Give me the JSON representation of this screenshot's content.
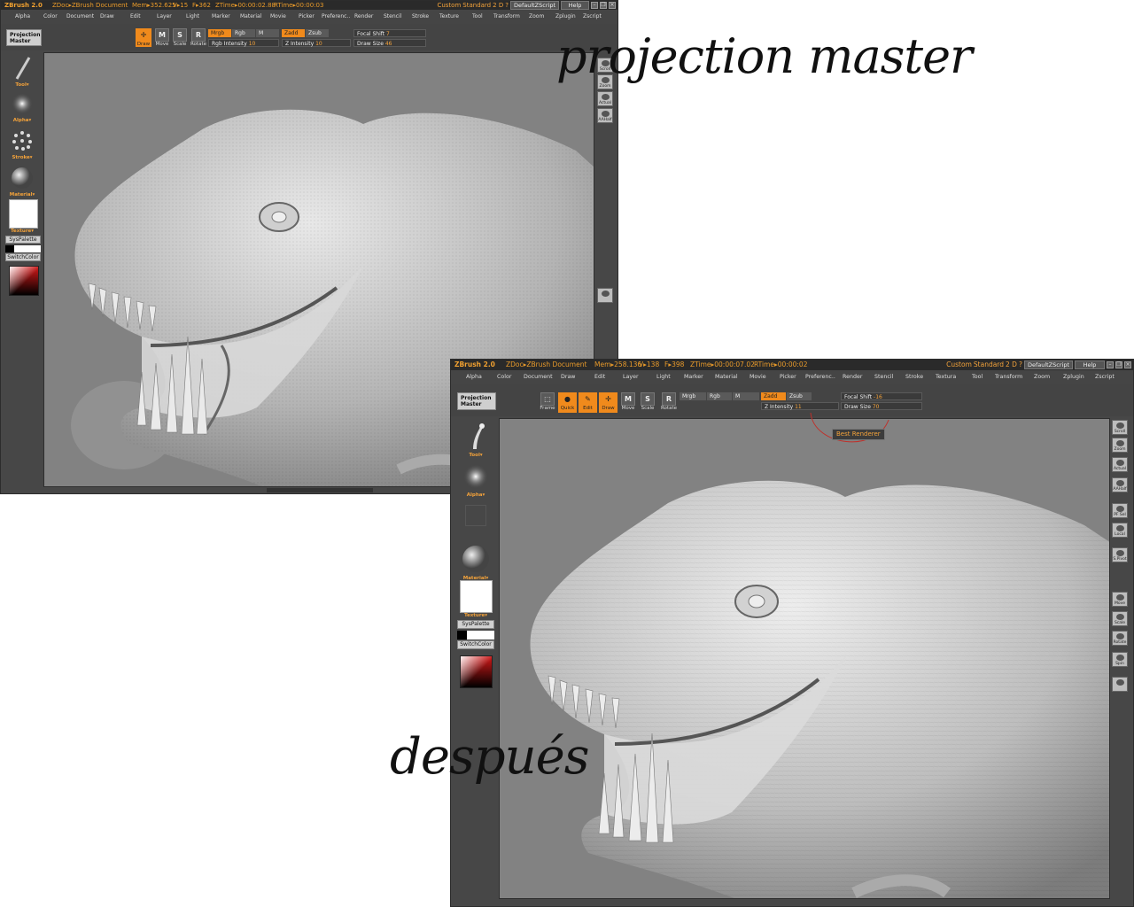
{
  "captions": {
    "top": "projection master",
    "bottom": "después"
  },
  "window1": {
    "titlebar": {
      "app": "ZBrush 2.0",
      "doc": "ZDoc▸ZBrush Document",
      "mem": "Mem▸352.625",
      "v": "V▸15",
      "f": "F▸362",
      "ztime": "ZTime▸00:00:02.88",
      "rtime": "RTime▸00:00:03",
      "custom": "Custom",
      "standard": "Standard",
      "twod": "2 D",
      "question": "?",
      "default_script": "DefaultZScript",
      "help": "Help"
    },
    "menus": [
      "Alpha",
      "Color",
      "Document",
      "Draw",
      "Edit",
      "Layer",
      "Light",
      "Marker",
      "Material",
      "Movie",
      "Picker",
      "Preferenc..",
      "Render",
      "Stencil",
      "Stroke",
      "Texture",
      "Tool",
      "Transform",
      "Zoom",
      "Zplugin",
      "Zscript"
    ],
    "projection_master": [
      "Projection",
      "Master"
    ],
    "tools": [
      {
        "letter": "✛",
        "label": "Draw",
        "active": true
      },
      {
        "letter": "M",
        "label": "Move",
        "active": false
      },
      {
        "letter": "S",
        "label": "Scale",
        "active": false
      },
      {
        "letter": "R",
        "label": "Rotate",
        "active": false
      }
    ],
    "toggles": {
      "mrgb": "Mrgb",
      "rgb": "Rgb",
      "m": "M",
      "zadd": "Zadd",
      "zsub": "Zsub"
    },
    "sliders": {
      "rgb_intensity_label": "Rgb Intensity",
      "rgb_intensity_value": "10",
      "z_intensity_label": "Z Intensity",
      "z_intensity_value": "10",
      "focal_shift_label": "Focal Shift",
      "focal_shift_value": "7",
      "draw_size_label": "Draw Size",
      "draw_size_value": "46"
    },
    "left": {
      "tool": "Tool▾",
      "alpha": "Alpha▾",
      "stroke": "Stroke▾",
      "material": "Material▾",
      "texture": "Texture▾",
      "syspalette": "SysPalette",
      "switchcolor": "SwitchColor"
    },
    "right_buttons": [
      "Scroll",
      "Zoom",
      "Actual",
      "AAHalf"
    ]
  },
  "window2": {
    "titlebar": {
      "app": "ZBrush 2.0",
      "doc": "ZDoc▸ZBrush Document",
      "mem": "Mem▸258.136",
      "v": "V▸138",
      "f": "F▸398",
      "ztime": "ZTime▸00:00:07.02",
      "rtime": "RTime▸00:00:02",
      "custom": "Custom",
      "standard": "Standard",
      "twod": "2 D",
      "question": "?",
      "default_script": "DefaultZScript",
      "help": "Help"
    },
    "menus": [
      "Alpha",
      "Color",
      "Document",
      "Draw",
      "Edit",
      "Layer",
      "Light",
      "Marker",
      "Material",
      "Movie",
      "Picker",
      "Preferenc..",
      "Render",
      "Stencil",
      "Stroke",
      "Textura",
      "Tool",
      "Transform",
      "Zoom",
      "Zplugin",
      "Zscript"
    ],
    "projection_master": [
      "Projection",
      "Master"
    ],
    "tools": [
      {
        "letter": "⬚",
        "label": "Frame",
        "active": false
      },
      {
        "letter": "●",
        "label": "Quick",
        "active": true
      },
      {
        "letter": "✎",
        "label": "Edit",
        "active": true
      },
      {
        "letter": "✛",
        "label": "Draw",
        "active": true
      },
      {
        "letter": "M",
        "label": "Move",
        "active": false
      },
      {
        "letter": "S",
        "label": "Scale",
        "active": false
      },
      {
        "letter": "R",
        "label": "Rotate",
        "active": false
      }
    ],
    "toggles": {
      "mrgb": "Mrgb",
      "rgb": "Rgb",
      "m": "M",
      "zadd": "Zadd",
      "zsub": "Zsub"
    },
    "sliders": {
      "z_intensity_label": "Z Intensity",
      "z_intensity_value": "11",
      "focal_shift_label": "Focal Shift",
      "focal_shift_value": "-16",
      "draw_size_label": "Draw Size",
      "draw_size_value": "70"
    },
    "tooltip": "Best Renderer",
    "left": {
      "tool": "Tool▾",
      "alpha": "Alpha▾",
      "material": "Material▾",
      "texture": "Texture▾",
      "syspalette": "SysPalette",
      "switchcolor": "SwitchColor"
    },
    "right_buttons": [
      "Scroll",
      "Zoom",
      "Actual",
      "AAHalf",
      "PF Sel",
      "Local",
      "S.Pivot",
      "Move",
      "Scale",
      "Rotate",
      "Spin"
    ]
  }
}
